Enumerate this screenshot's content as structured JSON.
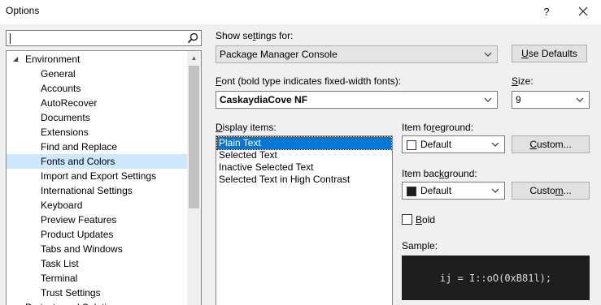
{
  "window": {
    "title": "Options",
    "help_glyph": "?",
    "close_glyph": "✕"
  },
  "search": {
    "value": ""
  },
  "tree": {
    "items": [
      {
        "label": "Environment",
        "expanded": true,
        "level": 0
      },
      {
        "label": "General",
        "level": 1
      },
      {
        "label": "Accounts",
        "level": 1
      },
      {
        "label": "AutoRecover",
        "level": 1
      },
      {
        "label": "Documents",
        "level": 1
      },
      {
        "label": "Extensions",
        "level": 1
      },
      {
        "label": "Find and Replace",
        "level": 1
      },
      {
        "label": "Fonts and Colors",
        "level": 1,
        "selected": true
      },
      {
        "label": "Import and Export Settings",
        "level": 1
      },
      {
        "label": "International Settings",
        "level": 1
      },
      {
        "label": "Keyboard",
        "level": 1
      },
      {
        "label": "Preview Features",
        "level": 1
      },
      {
        "label": "Product Updates",
        "level": 1
      },
      {
        "label": "Tabs and Windows",
        "level": 1
      },
      {
        "label": "Task List",
        "level": 1
      },
      {
        "label": "Terminal",
        "level": 1
      },
      {
        "label": "Trust Settings",
        "level": 1
      },
      {
        "label": "Projects and Solutions",
        "level": 0,
        "expanded": false
      }
    ]
  },
  "settings": {
    "show_settings_label_pre": "Show se",
    "show_settings_label_u": "t",
    "show_settings_label_post": "tings for:",
    "show_settings_value": "Package Manager Console",
    "use_defaults_u": "U",
    "use_defaults_rest": "se Defaults",
    "font_label_u": "F",
    "font_label_rest": "ont (bold type indicates fixed-width fonts):",
    "font_value": "CaskaydiaCove NF",
    "size_label_u": "S",
    "size_label_rest": "ize:",
    "size_value": "9",
    "display_items_label_pre": "",
    "display_items_label_u": "D",
    "display_items_label_post": "isplay items:",
    "display_items": [
      "Plain Text",
      "Selected Text",
      "Inactive Selected Text",
      "Selected Text in High Contrast"
    ],
    "fg_label_pre": "Item fo",
    "fg_label_u": "r",
    "fg_label_post": "eground:",
    "fg_value": "Default",
    "fg_color": "#ffffff",
    "custom1_pre": "",
    "custom1_u": "C",
    "custom1_post": "ustom...",
    "bg_label_pre": "Item bac",
    "bg_label_u": "k",
    "bg_label_post": "ground:",
    "bg_value": "Default",
    "bg_color": "#1e1e1e",
    "custom2_pre": "Custo",
    "custom2_u": "m",
    "custom2_post": "...",
    "bold_u": "B",
    "bold_rest": "old",
    "bold_checked": false,
    "sample_label": "Sample:",
    "sample_text": "ij = I::oO(0xB81l);"
  }
}
